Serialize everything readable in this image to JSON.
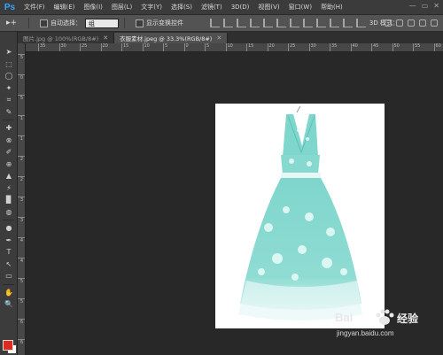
{
  "app": {
    "logo": "Ps"
  },
  "menu": [
    "文件(F)",
    "编辑(E)",
    "图像(I)",
    "图层(L)",
    "文字(Y)",
    "选择(S)",
    "滤镜(T)",
    "3D(D)",
    "视图(V)",
    "窗口(W)",
    "帮助(H)"
  ],
  "window_controls": {
    "minimize": "—",
    "restore": "▭",
    "close": "✕"
  },
  "options": {
    "tool_glyph": "▸+",
    "auto_select_label": "自动选择：",
    "auto_select_value": "组",
    "show_transform_label": "显示变换控件",
    "mode_3d_label": "3D 模式："
  },
  "tabs": [
    {
      "label": "图片.jpg @ 100%(RGB/8#)",
      "close": "✕"
    },
    {
      "label": "衣服素材.jpeg @ 33.3%(RGB/8#)",
      "close": "✕"
    }
  ],
  "ruler_top": [
    "35",
    "30",
    "25",
    "20",
    "15",
    "10",
    "5",
    "0",
    "5",
    "10",
    "15",
    "20",
    "25",
    "30",
    "35",
    "40",
    "45",
    "50",
    "55",
    "60"
  ],
  "ruler_left": [
    "5",
    "0",
    "5",
    "1",
    "1",
    "2",
    "2",
    "3",
    "3",
    "4",
    "4",
    "5",
    "5",
    "6",
    "6"
  ],
  "tools": [
    "➤",
    "⬚",
    "◯",
    "✦",
    "⌗",
    "✎",
    "✚",
    "⊗",
    "✐",
    "⊕",
    "▲",
    "⚡",
    "▉",
    "◍",
    "●",
    "✒",
    "T",
    "↖",
    "▭",
    "✋",
    "🔍"
  ],
  "colors": {
    "foreground": "#e02a1e",
    "background": "#ffffff",
    "dress": "#7fd6cc"
  },
  "watermark": {
    "brand": "Bai",
    "brand2": "经验",
    "url": "jingyan.baidu.com"
  }
}
